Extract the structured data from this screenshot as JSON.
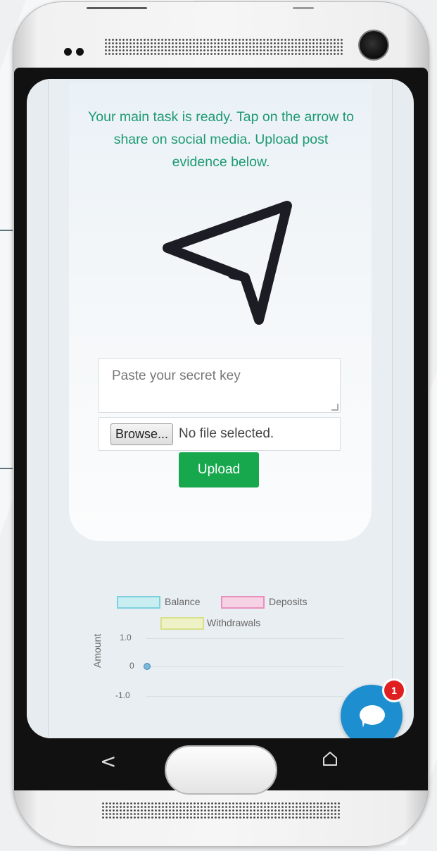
{
  "task": {
    "message": "Your main task is ready. Tap on the arrow to share on social media. Upload post evidence below.",
    "accent_color": "#1d9a72"
  },
  "form": {
    "secret_key_placeholder": "Paste your secret key",
    "browse_label": "Browse...",
    "file_status": "No file selected.",
    "upload_label": "Upload",
    "upload_color": "#17a84e"
  },
  "chart_data": {
    "type": "line",
    "series": [
      {
        "name": "Balance",
        "color": "#7fd0dd",
        "values": [
          0
        ]
      },
      {
        "name": "Deposits",
        "color": "#e98fbf",
        "values": [
          0
        ]
      },
      {
        "name": "Withdrawals",
        "color": "#d8e08a",
        "values": [
          0
        ]
      }
    ],
    "ylabel": "Amount",
    "yticks": [
      "1.0",
      "0",
      "-1.0"
    ],
    "ylim": [
      -1.0,
      1.0
    ],
    "legend_position": "top"
  },
  "chat": {
    "badge_count": "1"
  },
  "nav": {
    "back_glyph": "<"
  }
}
